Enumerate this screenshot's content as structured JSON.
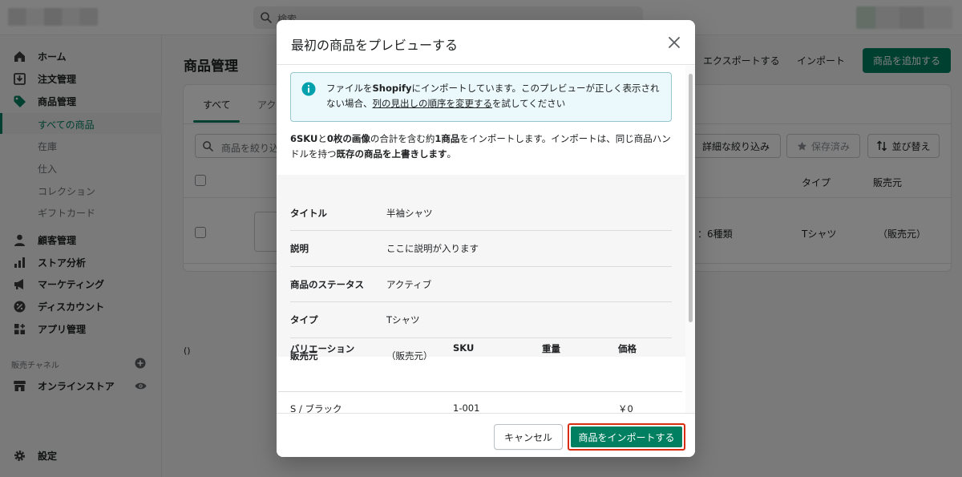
{
  "topbar": {
    "search_placeholder": "検索"
  },
  "sidebar": {
    "items": [
      {
        "label": "ホーム",
        "icon": "home-icon"
      },
      {
        "label": "注文管理",
        "icon": "orders-icon"
      },
      {
        "label": "商品管理",
        "icon": "tag-icon"
      }
    ],
    "sub_items": [
      "すべての商品",
      "在庫",
      "仕入",
      "コレクション",
      "ギフトカード"
    ],
    "items2": [
      {
        "label": "顧客管理",
        "icon": "person-icon"
      },
      {
        "label": "ストア分析",
        "icon": "analytics-icon"
      },
      {
        "label": "マーケティング",
        "icon": "megaphone-icon"
      },
      {
        "label": "ディスカウント",
        "icon": "discount-icon"
      },
      {
        "label": "アプリ管理",
        "icon": "apps-icon"
      }
    ],
    "channels_label": "販売チャネル",
    "online_store": "オンラインストア",
    "settings": "設定"
  },
  "page": {
    "title": "商品管理",
    "export": "エクスポートする",
    "import": "インポート",
    "add_product": "商品を追加する",
    "tabs": [
      "すべて",
      "アク"
    ],
    "filter_placeholder": "商品を絞り込",
    "btn_filter": "詳細な絞り込み",
    "btn_saved": "保存済み",
    "btn_sort": "並び替え",
    "columns": {
      "type": "タイプ",
      "vendor": "販売元"
    },
    "row": {
      "inventory": "：6種類",
      "type": "Tシャツ",
      "vendor": "（販売元）"
    },
    "paren": "()"
  },
  "modal": {
    "title": "最初の商品をプレビューする",
    "banner": {
      "pre": "ファイルを",
      "brand": "Shopify",
      "mid": "にインポートしています。このプレビューが正しく表示されない場合、",
      "link": "列の見出しの順序を変更する",
      "post": "を試してください"
    },
    "desc": {
      "sku": "6SKU",
      "t1": "と",
      "images": "0枚の画像",
      "t2": "の合計を含む約",
      "count": "1商品",
      "t3": "をインポートします。インポートは、同じ商品ハンドルを持つ",
      "overwrite": "既存の商品を上書きします",
      "t4": "。"
    },
    "fields": [
      {
        "key": "タイトル",
        "value": "半袖シャツ"
      },
      {
        "key": "説明",
        "value": "ここに説明が入ります"
      },
      {
        "key": "商品のステータス",
        "value": "アクティブ"
      },
      {
        "key": "タイプ",
        "value": "Tシャツ"
      },
      {
        "key": "販売元",
        "value": "（販売元）"
      }
    ],
    "variants": {
      "headers": [
        "バリエーション",
        "SKU",
        "重量",
        "価格"
      ],
      "rows": [
        [
          "S / ブラック",
          "1-001",
          "",
          "￥0"
        ]
      ]
    },
    "cancel": "キャンセル",
    "import_button": "商品をインポートする"
  }
}
